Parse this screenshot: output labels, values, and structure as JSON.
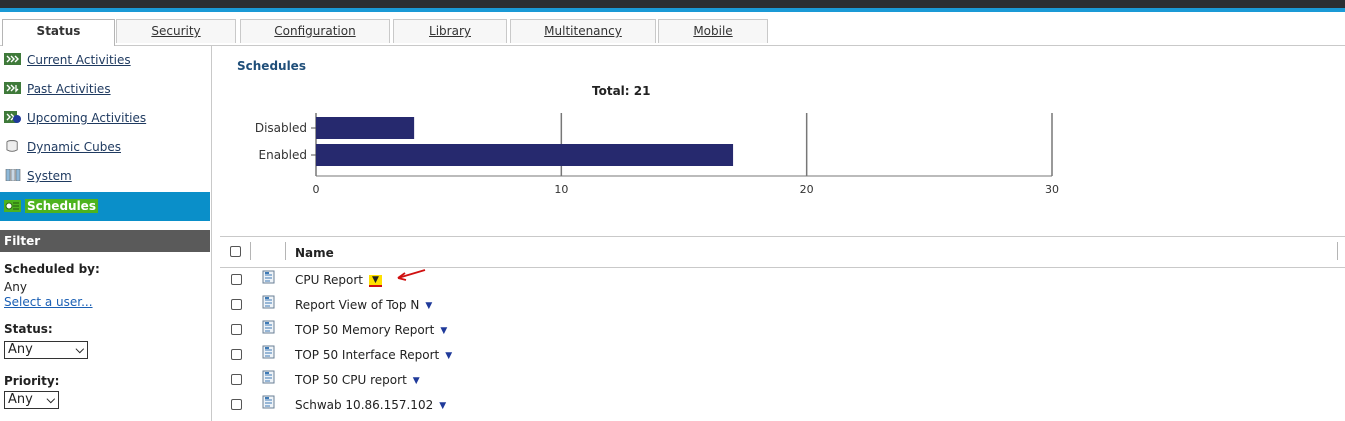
{
  "tabs": [
    {
      "label": "Status",
      "active": true
    },
    {
      "label": "Security"
    },
    {
      "label": "Configuration"
    },
    {
      "label": "Library"
    },
    {
      "label": "Multitenancy"
    },
    {
      "label": "Mobile"
    }
  ],
  "sidebar": {
    "items": [
      {
        "label": "Current Activities",
        "icon": "current-activities-icon"
      },
      {
        "label": "Past Activities",
        "icon": "past-activities-icon"
      },
      {
        "label": "Upcoming Activities",
        "icon": "upcoming-activities-icon"
      },
      {
        "label": "Dynamic Cubes",
        "icon": "cube-icon"
      },
      {
        "label": "System",
        "icon": "system-icon"
      },
      {
        "label": "Schedules",
        "icon": "schedule-icon",
        "selected": true
      }
    ]
  },
  "filter": {
    "title": "Filter",
    "scheduled_by_label": "Scheduled by:",
    "scheduled_by_value": "Any",
    "select_user_link": "Select a user...",
    "status_label": "Status:",
    "status_value": "Any",
    "priority_label": "Priority:",
    "priority_value": "Any"
  },
  "main": {
    "title": "Schedules",
    "grid": {
      "name_header": "Name",
      "rows": [
        {
          "name": "CPU Report",
          "menu_highlighted": true
        },
        {
          "name": "Report View of Top N"
        },
        {
          "name": "TOP 50 Memory Report"
        },
        {
          "name": "TOP 50 Interface Report"
        },
        {
          "name": "TOP 50 CPU report"
        },
        {
          "name": "Schwab 10.86.157.102"
        }
      ]
    }
  },
  "chart_data": {
    "type": "bar",
    "orientation": "horizontal",
    "title": "Total: 21",
    "categories": [
      "Disabled",
      "Enabled"
    ],
    "values": [
      4,
      17
    ],
    "xlim": [
      0,
      30
    ],
    "xticks": [
      0,
      10,
      20,
      30
    ],
    "grid": true,
    "bar_color": "#26296e"
  },
  "colors": {
    "selected_nav_bg": "#0a8fc9",
    "selected_nav_highlight": "#4db31f",
    "filter_header_bg": "#5a5a5a",
    "top_stripe": "#1a9ad6",
    "annotation_arrow": "#d01010",
    "annotation_highlight": "#ffe000"
  }
}
